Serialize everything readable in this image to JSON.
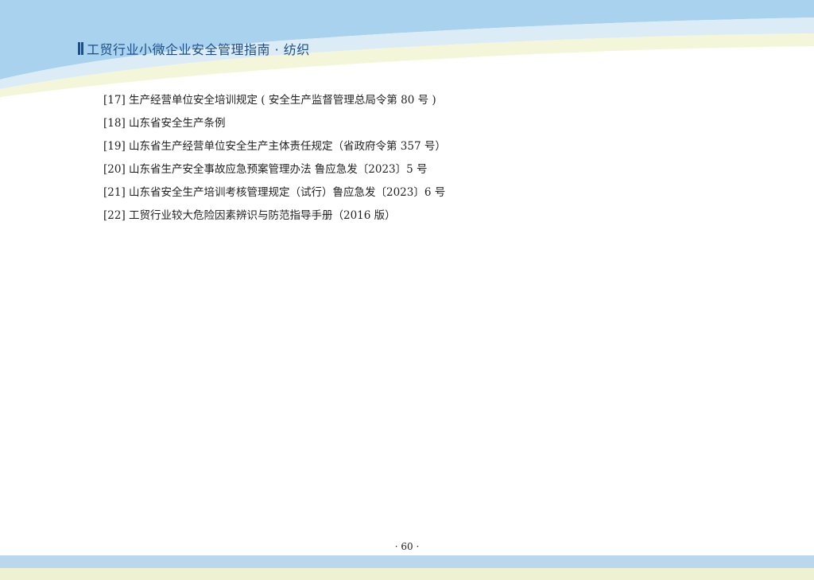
{
  "header": {
    "title": "工贸行业小微企业安全管理指南 · 纺织",
    "bar_icon": "double-bar-icon",
    "colors": {
      "accent": "#1e4e86",
      "wave_blue": "#a8d2ee",
      "wave_light": "#dcecf7",
      "wave_yellow": "#f4f6da"
    }
  },
  "references": [
    "[17] 生产经营单位安全培训规定 ( 安全生产监督管理总局令第 80 号 )",
    "[18] 山东省安全生产条例",
    "[19] 山东省生产经营单位安全生产主体责任规定（省政府令第 357 号）",
    "[20] 山东省生产安全事故应急预案管理办法 鲁应急发〔2023〕5 号",
    "[21] 山东省安全生产培训考核管理规定（试行）鲁应急发〔2023〕6 号",
    "[22] 工贸行业较大危险因素辨识与防范指导手册（2016 版）"
  ],
  "footer": {
    "page_number": "· 60 ·",
    "colors": {
      "band_blue": "#b9d8ee",
      "band_yellow": "#eef1d2"
    }
  }
}
